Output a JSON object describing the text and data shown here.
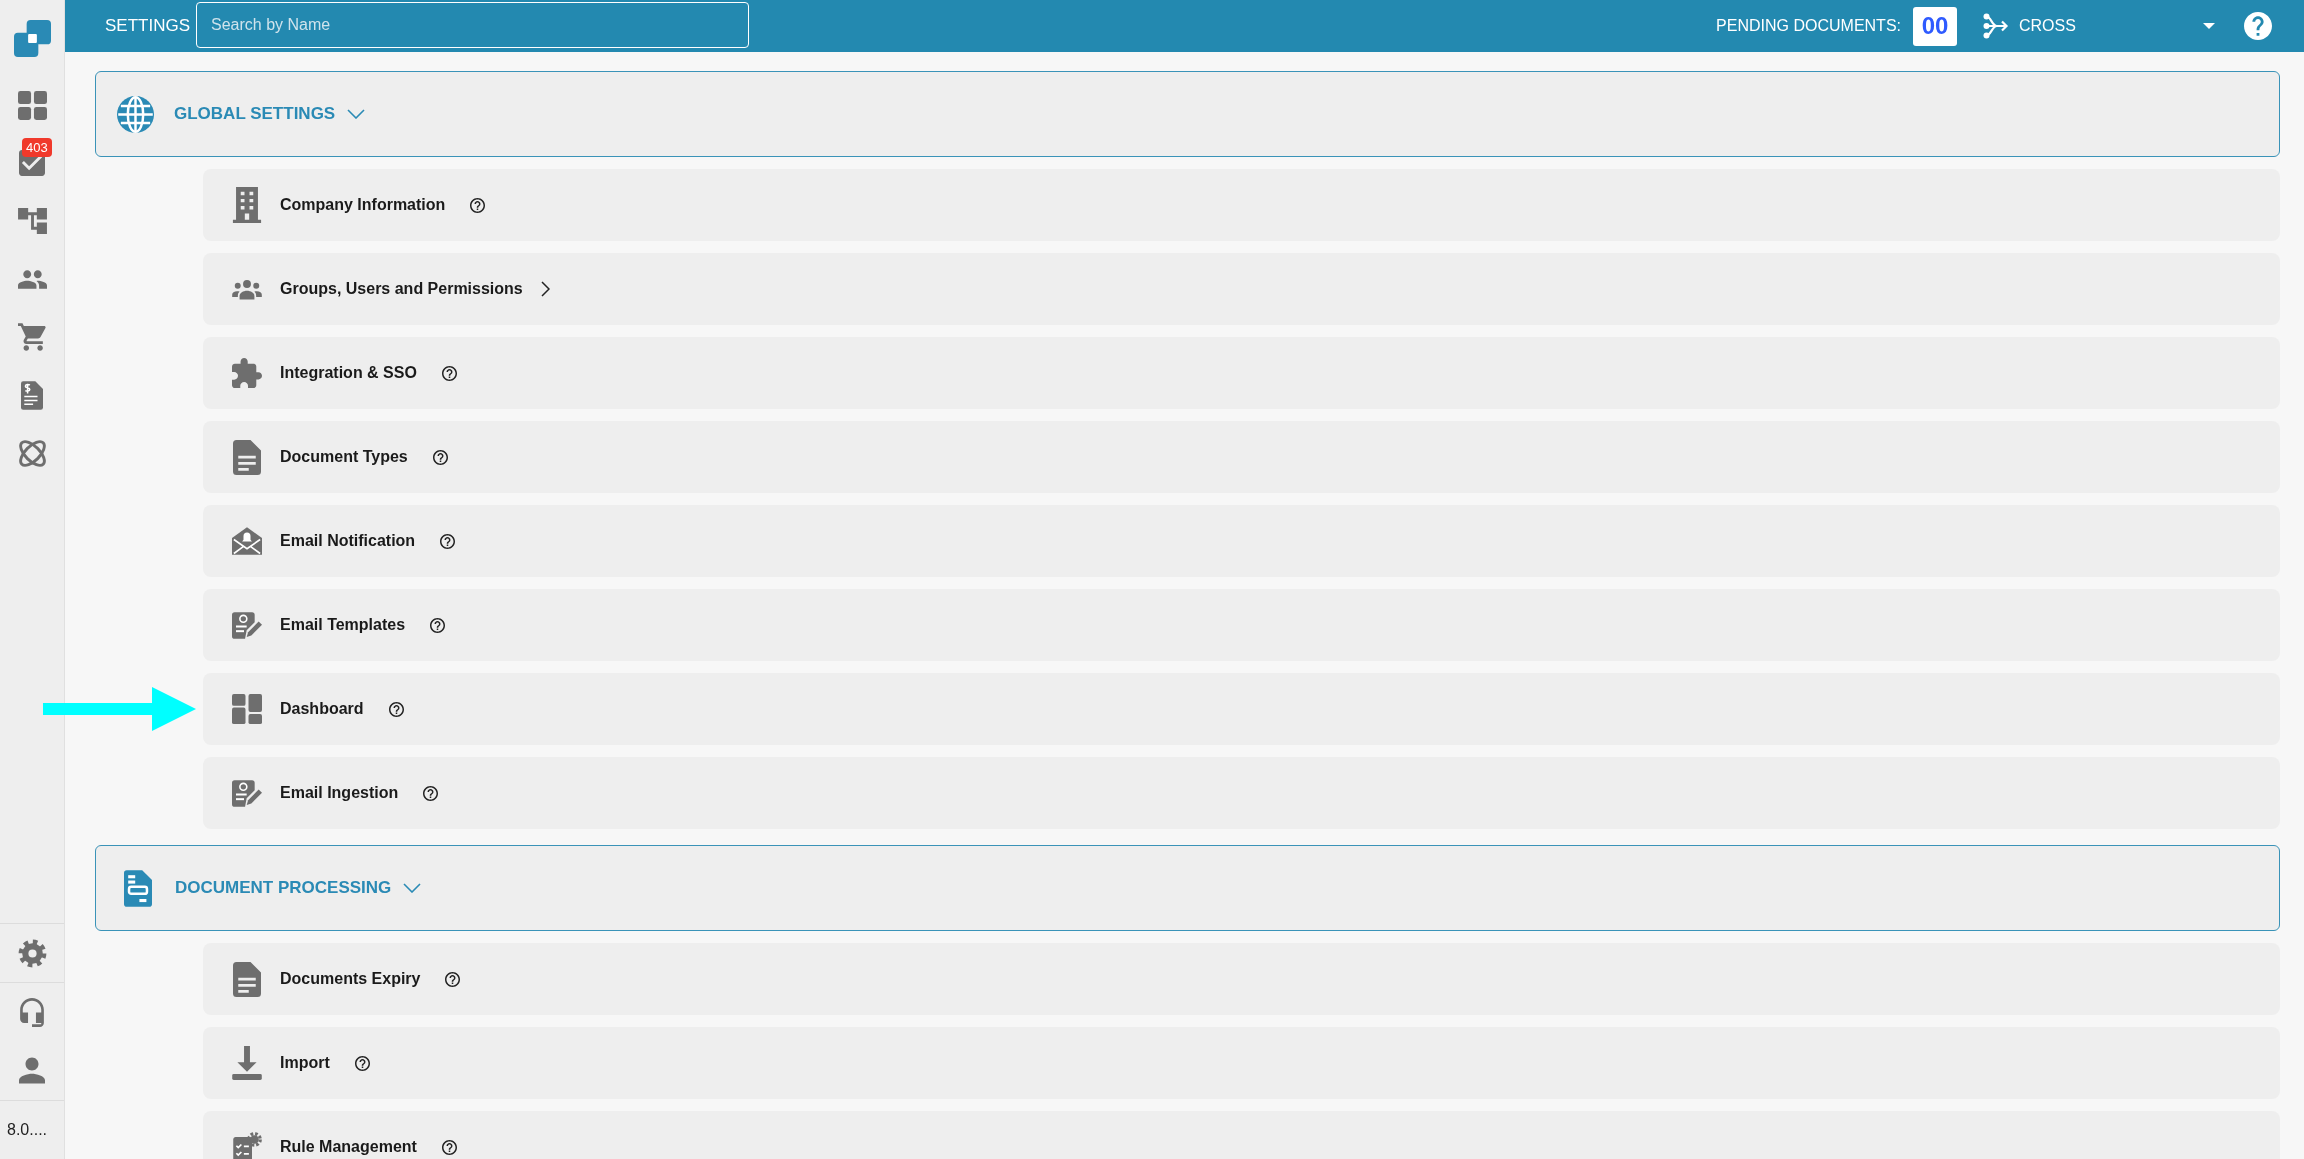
{
  "sidebar": {
    "badge": "403",
    "version": "8.0...."
  },
  "top_bar": {
    "title": "SETTINGS",
    "search": {
      "placeholder": "Search by Name"
    },
    "pending_label": "PENDING DOCUMENTS:",
    "pending_count": "00",
    "workspace": "CROSS"
  },
  "groups": [
    {
      "title": "GLOBAL SETTINGS",
      "expanded": true,
      "items": [
        {
          "label": "Company Information",
          "kind": "help",
          "pointed_at": false
        },
        {
          "label": "Groups, Users and Permissions",
          "kind": "submenu",
          "pointed_at": false
        },
        {
          "label": "Integration & SSO",
          "kind": "help",
          "pointed_at": false
        },
        {
          "label": "Document Types",
          "kind": "help",
          "pointed_at": false
        },
        {
          "label": "Email Notification",
          "kind": "help",
          "pointed_at": false
        },
        {
          "label": "Email Templates",
          "kind": "help",
          "pointed_at": false
        },
        {
          "label": "Dashboard",
          "kind": "help",
          "pointed_at": true
        },
        {
          "label": "Email Ingestion",
          "kind": "help",
          "pointed_at": false
        }
      ]
    },
    {
      "title": "DOCUMENT PROCESSING",
      "expanded": true,
      "items": [
        {
          "label": "Documents Expiry",
          "kind": "help",
          "pointed_at": false
        },
        {
          "label": "Import",
          "kind": "help",
          "pointed_at": false
        },
        {
          "label": "Rule Management",
          "kind": "help",
          "pointed_at": false
        }
      ]
    }
  ]
}
